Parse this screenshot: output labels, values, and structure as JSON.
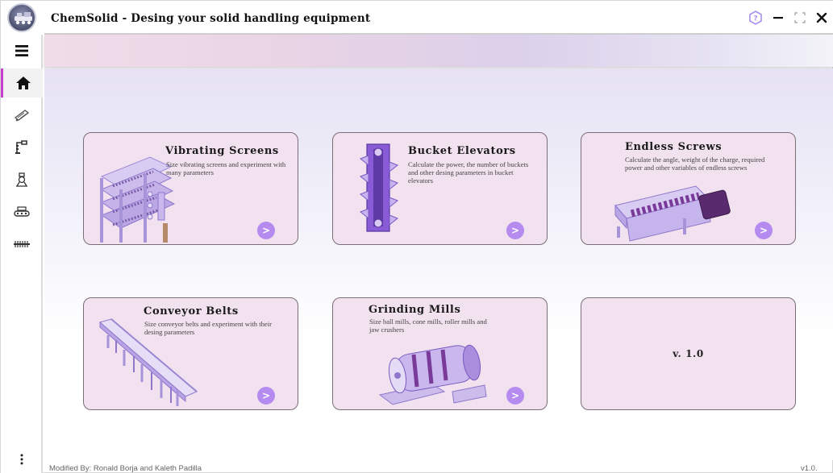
{
  "window": {
    "title": "ChemSolid - Desing your solid handling equipment",
    "controls": {
      "help": "help-icon",
      "minimize": "minimize-icon",
      "maximize": "maximize-icon",
      "close": "close-icon"
    }
  },
  "sidebar": {
    "items": [
      {
        "icon": "menu-icon"
      },
      {
        "icon": "home-icon",
        "active": true
      },
      {
        "icon": "vibrating-screen-icon"
      },
      {
        "icon": "bucket-elevator-icon"
      },
      {
        "icon": "grinding-mill-icon"
      },
      {
        "icon": "conveyor-belt-icon"
      },
      {
        "icon": "endless-screw-icon"
      }
    ],
    "more": {
      "icon": "more-vertical-icon"
    }
  },
  "cards": {
    "vibrating_screens": {
      "title": "Vibrating Screens",
      "description": "Size vibrating screens and experiment with many parameters",
      "button": ">"
    },
    "bucket_elevators": {
      "title": "Bucket Elevators",
      "description": "Calculate the power, the number of buckets and other desing parameters in bucket elevators",
      "button": ">"
    },
    "endless_screws": {
      "title": "Endless Screws",
      "description": "Calculate the angle, weight of the charge, required power and other variables of endless screws",
      "button": ">"
    },
    "conveyor_belts": {
      "title": "Conveyor Belts",
      "description": "Size conveyor belts and experiment with their desing parameters",
      "button": ">"
    },
    "grinding_mills": {
      "title": "Grinding Mills",
      "description": "Size ball mills, cone mills, roller mills and jaw crushers",
      "button": ">"
    },
    "version": {
      "label": "v. 1.0"
    }
  },
  "footer": {
    "credits": "Modified By: Ronald Borja and Kaleth Padilla",
    "version": "v1.0."
  },
  "colors": {
    "accent": "#c83fd0",
    "card_bg": "#f2e2ef",
    "button": "#b58bf0",
    "equipment": "#8f6fd8"
  }
}
